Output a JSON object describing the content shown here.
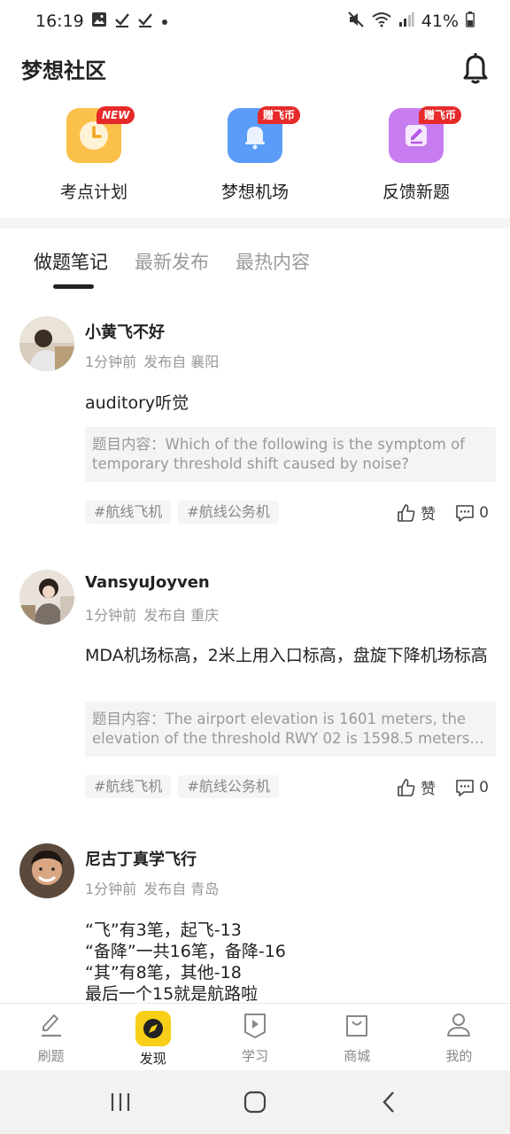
{
  "status_bar": {
    "time": "16:19",
    "battery": "41%"
  },
  "header": {
    "title": "梦想社区"
  },
  "tiles": [
    {
      "label": "考点计划",
      "badge": "NEW",
      "color": "#fbc04a"
    },
    {
      "label": "梦想机场",
      "badge": "赠飞币",
      "color": "#5a9cf7"
    },
    {
      "label": "反馈新题",
      "badge": "赠飞币",
      "color": "#c77df0"
    }
  ],
  "tabs": [
    {
      "label": "做题笔记",
      "active": true
    },
    {
      "label": "最新发布",
      "active": false
    },
    {
      "label": "最热内容",
      "active": false
    }
  ],
  "posts": [
    {
      "author": "小黄飞不好",
      "time": "1分钟前",
      "location": "发布自 襄阳",
      "content": "auditory听觉",
      "quote_lines": [
        "题目内容：Which of the following is the symptom of",
        "temporary threshold shift  caused by  noise?"
      ],
      "tags": [
        "#航线飞机",
        "#航线公务机"
      ],
      "like_label": "赞",
      "comment_count": "0"
    },
    {
      "author": "VansyuJoyven",
      "time": "1分钟前",
      "location": "发布自 重庆",
      "content": "MDA机场标高，2米上用入口标高，盘旋下降机场标高",
      "quote_lines": [
        "题目内容：The airport elevation is 1601 meters, the",
        "elevation of the threshold RWY 02 is 1598.5 meters, an..."
      ],
      "tags": [
        "#航线飞机",
        "#航线公务机"
      ],
      "like_label": "赞",
      "comment_count": "0"
    },
    {
      "author": "尼古丁真学飞行",
      "time": "1分钟前",
      "location": "发布自 青岛",
      "content": "“飞”有3笔，起飞-13\n“备降”一共16笔，备降-16\n“其”有8笔，其他-18\n最后一个15就是航路啦"
    }
  ],
  "bottom_nav": [
    {
      "label": "刷题",
      "icon": "pencil-icon",
      "active": false
    },
    {
      "label": "发现",
      "icon": "compass-icon",
      "active": true
    },
    {
      "label": "学习",
      "icon": "play-icon",
      "active": false
    },
    {
      "label": "商城",
      "icon": "shop-bag-icon",
      "active": false
    },
    {
      "label": "我的",
      "icon": "person-icon",
      "active": false
    }
  ],
  "colors": {
    "accent": "#f7cf18",
    "badge_red": "#e62a2a"
  }
}
